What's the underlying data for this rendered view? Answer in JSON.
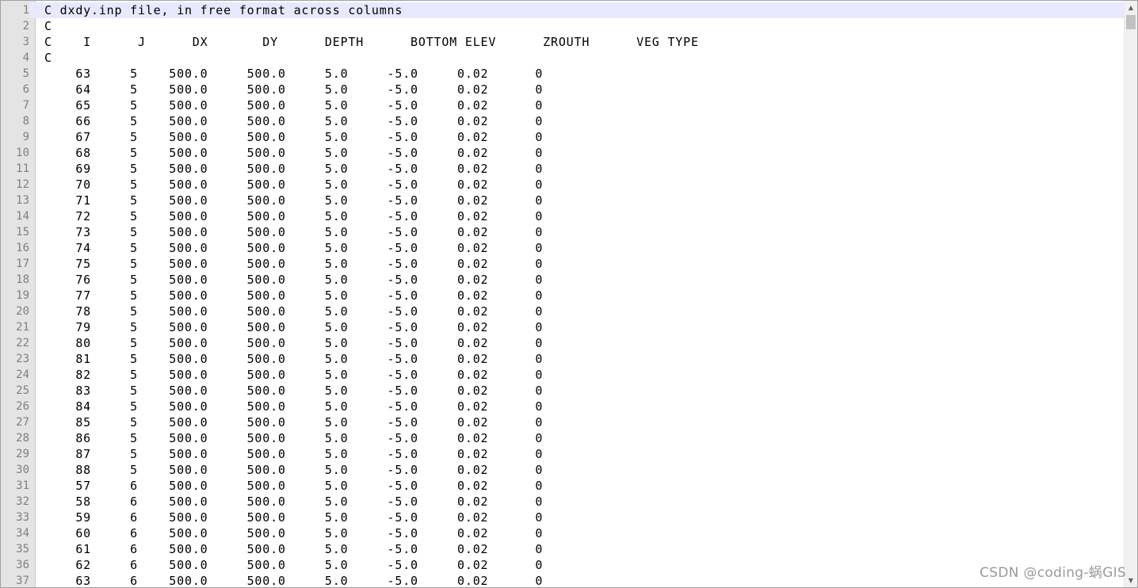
{
  "editor": {
    "current_line": 1,
    "lines": [
      "C dxdy.inp file, in free format across columns",
      "C",
      "C    I      J      DX       DY      DEPTH      BOTTOM ELEV      ZROUTH      VEG TYPE",
      "C",
      "    63     5    500.0     500.0     5.0     -5.0     0.02      0",
      "    64     5    500.0     500.0     5.0     -5.0     0.02      0",
      "    65     5    500.0     500.0     5.0     -5.0     0.02      0",
      "    66     5    500.0     500.0     5.0     -5.0     0.02      0",
      "    67     5    500.0     500.0     5.0     -5.0     0.02      0",
      "    68     5    500.0     500.0     5.0     -5.0     0.02      0",
      "    69     5    500.0     500.0     5.0     -5.0     0.02      0",
      "    70     5    500.0     500.0     5.0     -5.0     0.02      0",
      "    71     5    500.0     500.0     5.0     -5.0     0.02      0",
      "    72     5    500.0     500.0     5.0     -5.0     0.02      0",
      "    73     5    500.0     500.0     5.0     -5.0     0.02      0",
      "    74     5    500.0     500.0     5.0     -5.0     0.02      0",
      "    75     5    500.0     500.0     5.0     -5.0     0.02      0",
      "    76     5    500.0     500.0     5.0     -5.0     0.02      0",
      "    77     5    500.0     500.0     5.0     -5.0     0.02      0",
      "    78     5    500.0     500.0     5.0     -5.0     0.02      0",
      "    79     5    500.0     500.0     5.0     -5.0     0.02      0",
      "    80     5    500.0     500.0     5.0     -5.0     0.02      0",
      "    81     5    500.0     500.0     5.0     -5.0     0.02      0",
      "    82     5    500.0     500.0     5.0     -5.0     0.02      0",
      "    83     5    500.0     500.0     5.0     -5.0     0.02      0",
      "    84     5    500.0     500.0     5.0     -5.0     0.02      0",
      "    85     5    500.0     500.0     5.0     -5.0     0.02      0",
      "    86     5    500.0     500.0     5.0     -5.0     0.02      0",
      "    87     5    500.0     500.0     5.0     -5.0     0.02      0",
      "    88     5    500.0     500.0     5.0     -5.0     0.02      0",
      "    57     6    500.0     500.0     5.0     -5.0     0.02      0",
      "    58     6    500.0     500.0     5.0     -5.0     0.02      0",
      "    59     6    500.0     500.0     5.0     -5.0     0.02      0",
      "    60     6    500.0     500.0     5.0     -5.0     0.02      0",
      "    61     6    500.0     500.0     5.0     -5.0     0.02      0",
      "    62     6    500.0     500.0     5.0     -5.0     0.02      0",
      "    63     6    500.0     500.0     5.0     -5.0     0.02      0"
    ]
  },
  "scrollbar": {
    "up_icon": "scroll-up-arrow-icon",
    "down_icon": "scroll-down-arrow-icon"
  },
  "watermark": "CSDN @coding-蜗GIS"
}
